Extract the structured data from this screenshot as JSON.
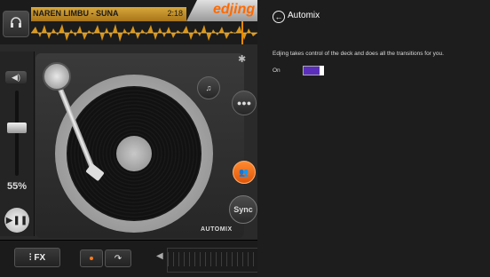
{
  "app": {
    "track_title": "NAREN LIMBU - SUNA",
    "track_time": "2:18",
    "logo": "edjing",
    "volume_percent": "55%",
    "automix_label": "AUTOMIX",
    "sync_label": "Sync",
    "fx_label": "FX",
    "accent_color": "#ff7a1a",
    "waveform_color": "#e6a21a"
  },
  "settings": {
    "title": "Automix",
    "description": "Edjing takes control of the deck and does all the transitions for you.",
    "toggle_label": "On",
    "toggle_state": "on",
    "toggle_color": "#5b2fbb"
  }
}
